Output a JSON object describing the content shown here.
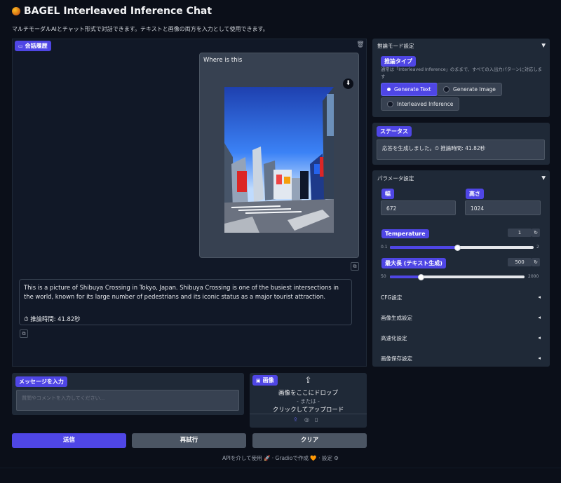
{
  "header": {
    "title": "BAGEL Interleaved Inference Chat",
    "subtitle": "マルチモーダルAIとチャット形式で対話できます。テキストと画像の両方を入力として使用できます。"
  },
  "chat": {
    "label": "会話履歴",
    "user_message": "Where is this",
    "bot_message": "This is a picture of Shibuya Crossing in Tokyo, Japan. Shibuya Crossing is one of the busiest intersections in the world, known for its large number of pedestrians and its iconic status as a major tourist attraction.",
    "bot_timing": "⏱ 推論時間: 41.82秒"
  },
  "inference_mode": {
    "section_label": "推論モード設定",
    "type_label": "推論タイプ",
    "type_info": "通常は「Interleaved Inference」のままで、すべての入出力パターンに対応します",
    "options": [
      "Generate Text",
      "Generate Image",
      "Interleaved Inference"
    ],
    "selected": "Generate Text"
  },
  "status": {
    "label": "ステータス",
    "text": "応答を生成しました。⏱ 推論時間: 41.82秒"
  },
  "params": {
    "section_label": "パラメータ設定",
    "width_label": "幅",
    "width_value": "672",
    "height_label": "高さ",
    "height_value": "1024",
    "temperature": {
      "label": "Temperature",
      "value": "1",
      "min": "0.1",
      "max": "2",
      "fraction": 0.47
    },
    "max_length": {
      "label": "最大長 (テキスト生成)",
      "value": "500",
      "min": "50",
      "max": "2000",
      "fraction": 0.23
    },
    "accordions": [
      "CFG設定",
      "画像生成設定",
      "高速化設定",
      "画像保存設定"
    ]
  },
  "message_input": {
    "label": "メッセージを入力",
    "placeholder": "質問やコメントを入力してください..."
  },
  "image_upload": {
    "label": "画像",
    "drop_text": "画像をここにドロップ",
    "or_text": "- または -",
    "click_text": "クリックしてアップロード"
  },
  "buttons": {
    "send": "送信",
    "retry": "再試行",
    "clear": "クリア"
  },
  "footer": {
    "api": "APIを介して使用",
    "gradio": "Gradioで作成",
    "settings": "設定"
  },
  "colors": {
    "accent": "#4f46e5",
    "panel": "#1f2937",
    "background": "#0b0f19"
  }
}
